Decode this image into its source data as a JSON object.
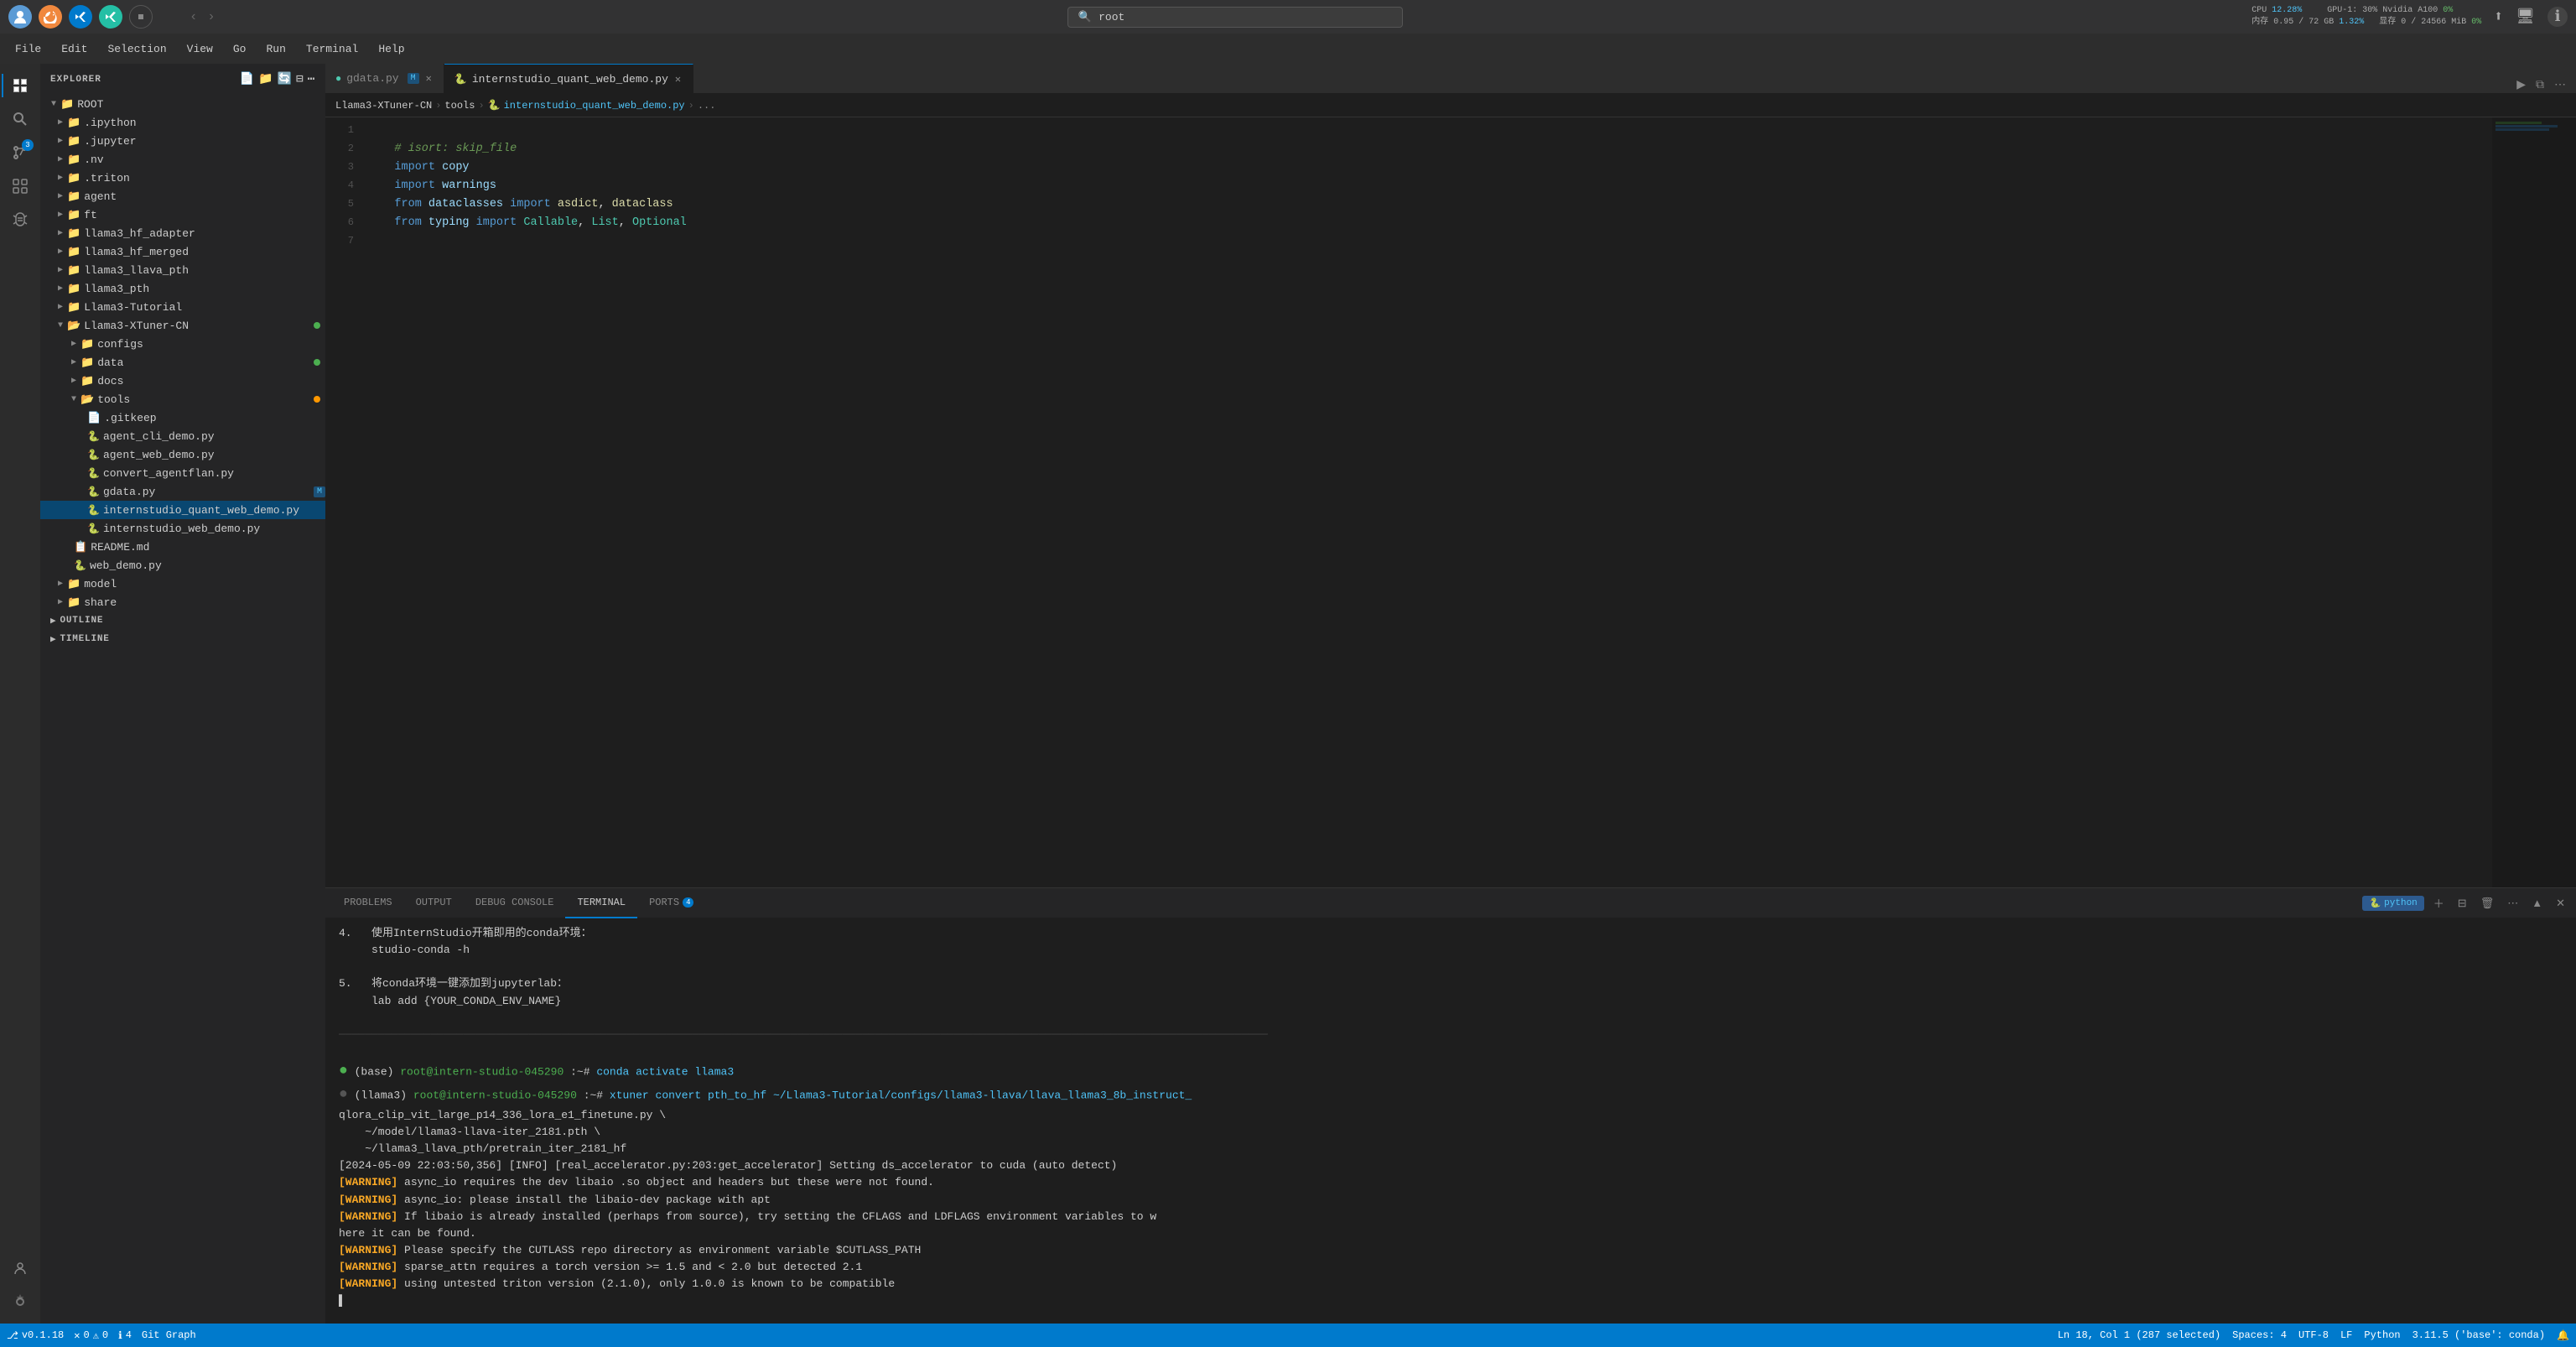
{
  "titlebar": {
    "icons": [
      "avatar",
      "sync",
      "vscode",
      "vscode-insiders"
    ],
    "cpu_label": "CPU",
    "cpu_val": "12.28%",
    "gpu_label": "GPU-1: 30% Nvidia A100",
    "gpu_val": "0%",
    "mem_label": "内存 0.95 / 72 GB",
    "mem_val": "1.32%",
    "storage_label": "显存 0 / 24566 MiB",
    "storage_val": "0%",
    "search_placeholder": "root"
  },
  "menubar": {
    "items": [
      "File",
      "Edit",
      "Selection",
      "View",
      "Go",
      "Run",
      "Terminal",
      "Help"
    ]
  },
  "sidebar": {
    "header": "EXPLORER",
    "root_label": "ROOT",
    "tree": [
      {
        "label": ".ipython",
        "indent": 1,
        "type": "folder",
        "collapsed": true
      },
      {
        "label": ".jupyter",
        "indent": 1,
        "type": "folder",
        "collapsed": true
      },
      {
        "label": ".nv",
        "indent": 1,
        "type": "folder",
        "collapsed": true
      },
      {
        "label": ".triton",
        "indent": 1,
        "type": "folder",
        "collapsed": true
      },
      {
        "label": "agent",
        "indent": 1,
        "type": "folder",
        "collapsed": true
      },
      {
        "label": "ft",
        "indent": 1,
        "type": "folder",
        "collapsed": true
      },
      {
        "label": "llama3_hf_adapter",
        "indent": 1,
        "type": "folder",
        "collapsed": true
      },
      {
        "label": "llama3_hf_merged",
        "indent": 1,
        "type": "folder",
        "collapsed": true
      },
      {
        "label": "llama3_llava_pth",
        "indent": 1,
        "type": "folder",
        "collapsed": true
      },
      {
        "label": "llama3_pth",
        "indent": 1,
        "type": "folder",
        "collapsed": true
      },
      {
        "label": "Llama3-Tutorial",
        "indent": 1,
        "type": "folder",
        "collapsed": true
      },
      {
        "label": "Llama3-XTuner-CN",
        "indent": 1,
        "type": "folder",
        "collapsed": false,
        "badge": "green"
      },
      {
        "label": "configs",
        "indent": 2,
        "type": "folder",
        "collapsed": true
      },
      {
        "label": "data",
        "indent": 2,
        "type": "folder",
        "collapsed": true,
        "badge": "green"
      },
      {
        "label": "docs",
        "indent": 2,
        "type": "folder",
        "collapsed": true
      },
      {
        "label": "tools",
        "indent": 2,
        "type": "folder",
        "collapsed": false,
        "badge": "yellow"
      },
      {
        "label": ".gitkeep",
        "indent": 3,
        "type": "file-plain"
      },
      {
        "label": "agent_cli_demo.py",
        "indent": 3,
        "type": "file-py"
      },
      {
        "label": "agent_web_demo.py",
        "indent": 3,
        "type": "file-py"
      },
      {
        "label": "convert_agentflan.py",
        "indent": 3,
        "type": "file-py"
      },
      {
        "label": "gdata.py",
        "indent": 3,
        "type": "file-py",
        "modified": true
      },
      {
        "label": "internstudio_quant_web_demo.py",
        "indent": 3,
        "type": "file-py",
        "active": true
      },
      {
        "label": "internstudio_web_demo.py",
        "indent": 3,
        "type": "file-py"
      },
      {
        "label": "README.md",
        "indent": 2,
        "type": "file-md"
      },
      {
        "label": "web_demo.py",
        "indent": 2,
        "type": "file-py"
      },
      {
        "label": "model",
        "indent": 1,
        "type": "folder",
        "collapsed": true
      },
      {
        "label": "share",
        "indent": 1,
        "type": "folder",
        "collapsed": true
      }
    ],
    "outline_label": "OUTLINE",
    "timeline_label": "TIMELINE"
  },
  "breadcrumb": {
    "items": [
      "Llama3-XTuner-CN",
      "tools",
      "internstudio_quant_web_demo.py",
      "..."
    ]
  },
  "tabs": [
    {
      "label": "gdata.py",
      "modified": true,
      "active": false
    },
    {
      "label": "internstudio_quant_web_demo.py",
      "modified": false,
      "active": true
    }
  ],
  "code": {
    "lines": [
      {
        "num": "1",
        "tokens": []
      },
      {
        "num": "2",
        "tokens": [
          {
            "t": "cm",
            "v": "    # isort: skip_file"
          }
        ]
      },
      {
        "num": "3",
        "tokens": [
          {
            "t": "kw",
            "v": "    import "
          },
          {
            "t": "var",
            "v": "copy"
          }
        ]
      },
      {
        "num": "4",
        "tokens": [
          {
            "t": "kw",
            "v": "    import "
          },
          {
            "t": "var",
            "v": "warnings"
          }
        ]
      },
      {
        "num": "5",
        "tokens": [
          {
            "t": "kw",
            "v": "    from "
          },
          {
            "t": "var",
            "v": "dataclasses"
          },
          {
            "t": "kw",
            "v": " import "
          },
          {
            "t": "var",
            "v": "asdict"
          },
          {
            "t": "op",
            "v": ", "
          },
          {
            "t": "var",
            "v": "dataclass"
          }
        ]
      },
      {
        "num": "6",
        "tokens": [
          {
            "t": "kw",
            "v": "    from "
          },
          {
            "t": "var",
            "v": "typing"
          },
          {
            "t": "kw",
            "v": " import "
          },
          {
            "t": "var",
            "v": "Callable"
          },
          {
            "t": "op",
            "v": ", "
          },
          {
            "t": "var",
            "v": "List"
          },
          {
            "t": "op",
            "v": ", "
          },
          {
            "t": "var",
            "v": "Optional"
          }
        ]
      },
      {
        "num": "7",
        "tokens": []
      }
    ]
  },
  "terminal": {
    "content_lines": [
      {
        "type": "normal",
        "text": "4.   使用InternStudio开箱即用的conda环境："
      },
      {
        "type": "normal",
        "text": "     studio-conda -h"
      },
      {
        "type": "blank"
      },
      {
        "type": "normal",
        "text": "5.   将conda环境一键添加到jupyterlab："
      },
      {
        "type": "normal",
        "text": "     lab add {YOUR_CONDA_ENV_NAME}"
      },
      {
        "type": "blank"
      },
      {
        "type": "separator"
      },
      {
        "type": "blank"
      },
      {
        "type": "prompt_green",
        "prompt": "(base)  root@intern-studio-045290:~#",
        "cmd": " conda activate llama3"
      },
      {
        "type": "prompt_grey",
        "prompt": "(llama3)  root@intern-studio-045290:~#",
        "cmd": " xtuner convert pth_to_hf ~/Llama3-Tutorial/configs/llama3-llava/llava_llama3_8b_instruct_qlora_clip_vit_large_p14_336_lora_e1_finetune.py \\"
      },
      {
        "type": "normal",
        "text": "    ~/model/llama3-llava-iter_2181.pth \\"
      },
      {
        "type": "normal",
        "text": "    ~/llama3_llava_pth/pretrain_iter_2181_hf"
      },
      {
        "type": "info",
        "text": "[2024-05-09 22:03:50,356] [INFO] [real_accelerator.py:203:get_accelerator] Setting ds_accelerator to cuda (auto detect)"
      },
      {
        "type": "warning_badge",
        "badge": "[WARNING]",
        "text": " async_io requires the dev libaio .so object and headers but these were not found."
      },
      {
        "type": "warning_badge",
        "badge": "[WARNING]",
        "text": " async_io: please install the libaio-dev package with apt"
      },
      {
        "type": "warning_badge",
        "badge": "[WARNING]",
        "text": " If libaio is already installed (perhaps from source), try setting the CFLAGS and LDFLAGS environment variables to w"
      },
      {
        "type": "normal",
        "text": "here it can be found."
      },
      {
        "type": "warning_badge",
        "badge": "[WARNING]",
        "text": " Please specify the CUTLASS repo directory as environment variable $CUTLASS_PATH"
      },
      {
        "type": "warning_badge",
        "badge": "[WARNING]",
        "text": " sparse_attn requires a torch version >= 1.5 and < 2.0 but detected 2.1"
      },
      {
        "type": "warning_badge",
        "badge": "[WARNING]",
        "text": " using untested triton version (2.1.0), only 1.0.0 is known to be compatible"
      },
      {
        "type": "cursor"
      }
    ],
    "tabs": [
      "PROBLEMS",
      "OUTPUT",
      "DEBUG CONSOLE",
      "TERMINAL",
      "PORTS"
    ],
    "active_tab": "TERMINAL",
    "ports_badge": "4",
    "python_label": "python"
  },
  "statusbar": {
    "git_label": "v0.1.18",
    "errors": "0",
    "warnings": "0",
    "info": "4",
    "git_graph": "Git Graph",
    "ln_col": "Ln 18, Col 1 (287 selected)",
    "spaces": "Spaces: 4",
    "encoding": "UTF-8",
    "line_ending": "LF",
    "language": "Python",
    "python_version": "3.11.5 ('base': conda)"
  }
}
